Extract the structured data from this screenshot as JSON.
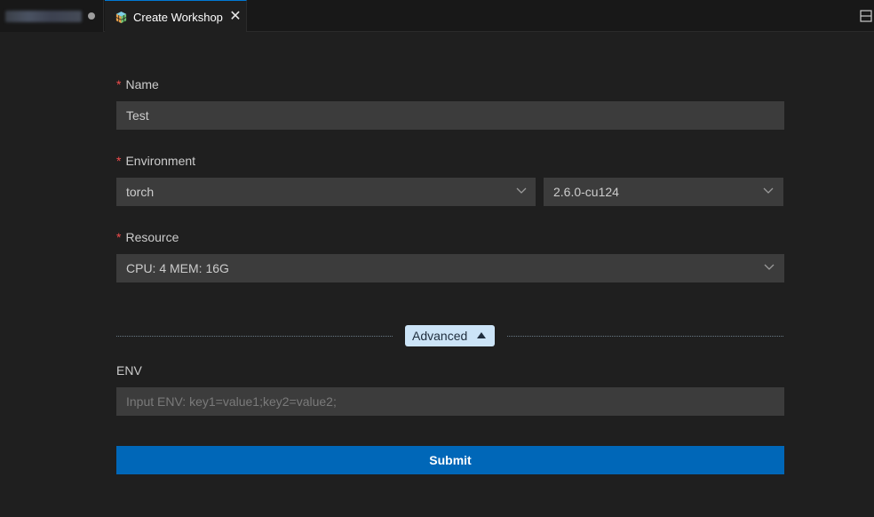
{
  "tabs": {
    "inactive": {
      "dirty": true
    },
    "active": {
      "label": "Create Workshop",
      "close_glyph": "✕",
      "icon": "cube-logo-icon"
    },
    "split_editor_icon": "split-editor-icon"
  },
  "form": {
    "name": {
      "required_marker": "*",
      "label": "Name",
      "value": "Test"
    },
    "environment": {
      "required_marker": "*",
      "label": "Environment",
      "framework_value": "torch",
      "version_value": "2.6.0-cu124"
    },
    "resource": {
      "required_marker": "*",
      "label": "Resource",
      "value": "CPU: 4 MEM: 16G"
    },
    "advanced": {
      "label": "Advanced",
      "expanded": true
    },
    "env": {
      "label": "ENV",
      "value": "",
      "placeholder": "Input ENV: key1=value1;key2=value2;"
    },
    "submit_label": "Submit"
  },
  "colors": {
    "background": "#1f1f1f",
    "input_background": "#3c3c3c",
    "required": "#f14c4c",
    "primary_button": "#0067b8",
    "advanced_badge": "#cce4f7",
    "active_tab_border": "#0078d4"
  }
}
